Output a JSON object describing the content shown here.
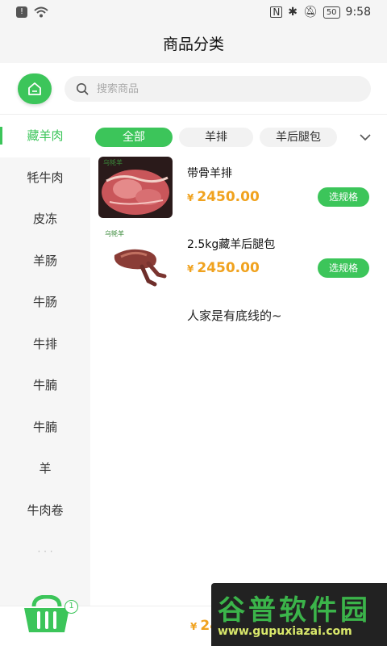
{
  "status_bar": {
    "time": "9:58",
    "battery": "50"
  },
  "header": {
    "title": "商品分类"
  },
  "search": {
    "placeholder": "搜索商品"
  },
  "sidebar": {
    "items": [
      {
        "label": "藏羊肉",
        "active": true
      },
      {
        "label": "牦牛肉"
      },
      {
        "label": "皮冻"
      },
      {
        "label": "羊肠"
      },
      {
        "label": "牛肠"
      },
      {
        "label": "牛排"
      },
      {
        "label": "牛腩"
      },
      {
        "label": "牛腩"
      },
      {
        "label": "羊"
      },
      {
        "label": "牛肉卷"
      }
    ]
  },
  "tabs": [
    {
      "label": "全部",
      "active": true
    },
    {
      "label": "羊排"
    },
    {
      "label": "羊后腿包"
    }
  ],
  "products": [
    {
      "name": "带骨羊排",
      "currency": "¥",
      "price": "2450.00",
      "button": "选规格",
      "thumb_logo": "乌牦羊"
    },
    {
      "name": "2.5kg藏羊后腿包",
      "currency": "¥",
      "price": "2450.00",
      "button": "选规格",
      "thumb_logo": "乌牦羊"
    }
  ],
  "end_note": "人家是有底线的~",
  "cart": {
    "count": "1",
    "currency": "¥",
    "total": "2450"
  },
  "watermark": {
    "title": "谷普软件园",
    "url": "www.gupuxiazai.com"
  },
  "colors": {
    "accent": "#3cc55a",
    "price": "#f0a21e"
  }
}
